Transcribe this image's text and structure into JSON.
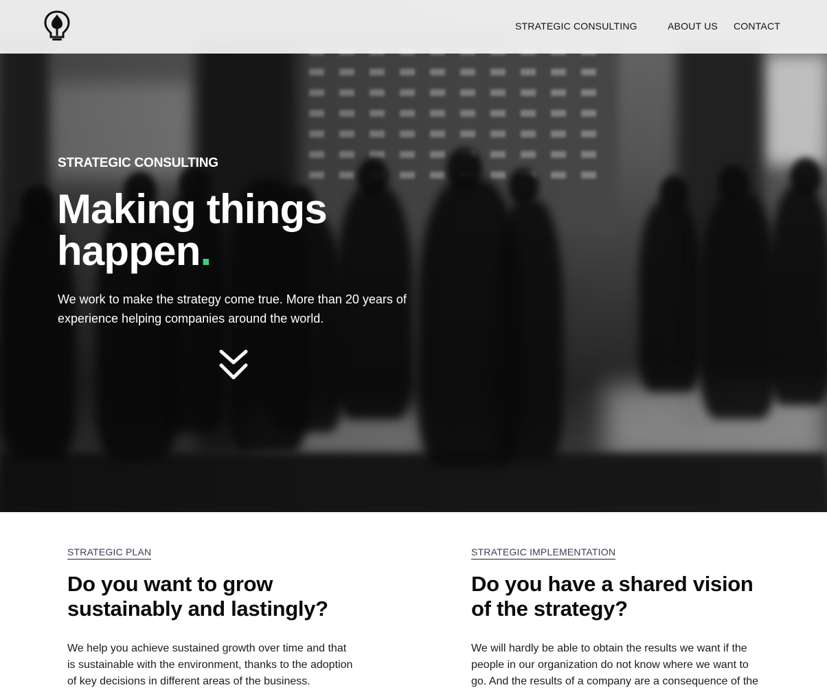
{
  "brand": {
    "logo_icon": "lightbulb-tree-icon"
  },
  "nav": {
    "items": [
      {
        "label": "STRATEGIC CONSULTING"
      },
      {
        "label": "ABOUT US"
      },
      {
        "label": "CONTACT"
      }
    ]
  },
  "hero": {
    "eyebrow": "STRATEGIC CONSULTING",
    "headline_line1": "Making things",
    "headline_line2": "happen",
    "headline_dot": ".",
    "lead": "We work to make the strategy come true. More than 20 years of experience helping companies around the world.",
    "scroll_icon": "double-chevron-down-icon",
    "accent_color": "#3ccf7a"
  },
  "sections": [
    {
      "tag": "STRATEGIC PLAN",
      "title": "Do you want to grow sustainably and lastingly?",
      "body": "We help you achieve sustained growth over time and that is sustainable with the environment, thanks to the adoption of key decisions in different areas of the business."
    },
    {
      "tag": "STRATEGIC IMPLEMENTATION",
      "title": "Do you have a shared vision of the strategy?",
      "body": "We will hardly be able to obtain the results we want if the people in our organization do not know where we want to go. And the results of a company are a consequence of the sum of the actions of the people."
    }
  ]
}
